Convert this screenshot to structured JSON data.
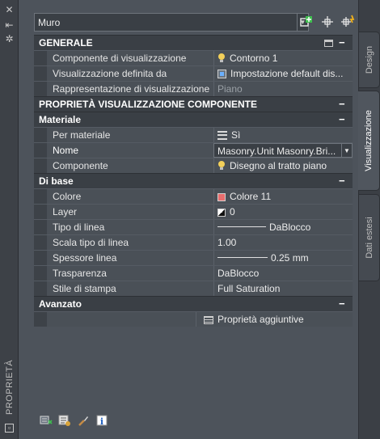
{
  "palette": {
    "title": "PROPRIETÀ"
  },
  "tabs": [
    {
      "label": "Design",
      "active": false
    },
    {
      "label": "Visualizzazione",
      "active": true
    },
    {
      "label": "Dati estesi",
      "active": false
    }
  ],
  "object_select": {
    "value": "Muro"
  },
  "sections": {
    "generale": {
      "title": "GENERALE",
      "rows": [
        {
          "label": "Componente di visualizzazione",
          "value": "Contorno 1"
        },
        {
          "label": "Visualizzazione definita da",
          "value": "Impostazione  default  dis..."
        },
        {
          "label": "Rappresentazione di visualizzazione",
          "value": "Piano"
        }
      ]
    },
    "proprieta": {
      "title": "PROPRIETÀ VISUALIZZAZIONE COMPONENTE"
    },
    "materiale": {
      "title": "Materiale",
      "rows": [
        {
          "label": "Per materiale",
          "value": "Sì"
        },
        {
          "label": "Nome",
          "value": "Masonry.Unit  Masonry.Bri..."
        },
        {
          "label": "Componente",
          "value": "Disegno al tratto piano"
        }
      ]
    },
    "dibase": {
      "title": "Di base",
      "rows": [
        {
          "label": "Colore",
          "value": "Colore 11"
        },
        {
          "label": "Layer",
          "value": "0"
        },
        {
          "label": "Tipo di linea",
          "value": "DaBlocco"
        },
        {
          "label": "Scala tipo di linea",
          "value": "1.00"
        },
        {
          "label": "Spessore linea",
          "value": "0.25 mm"
        },
        {
          "label": "Trasparenza",
          "value": "DaBlocco"
        },
        {
          "label": "Stile di stampa",
          "value": "Full Saturation"
        }
      ]
    },
    "avanzato": {
      "title": "Avanzato",
      "rows": [
        {
          "label": "",
          "value": "Proprietà aggiuntive"
        }
      ]
    }
  },
  "collapse_symbol": "−",
  "colors": {
    "swatch": "#e96e6e",
    "panel": "#4d535b",
    "header": "#3a3f45"
  }
}
